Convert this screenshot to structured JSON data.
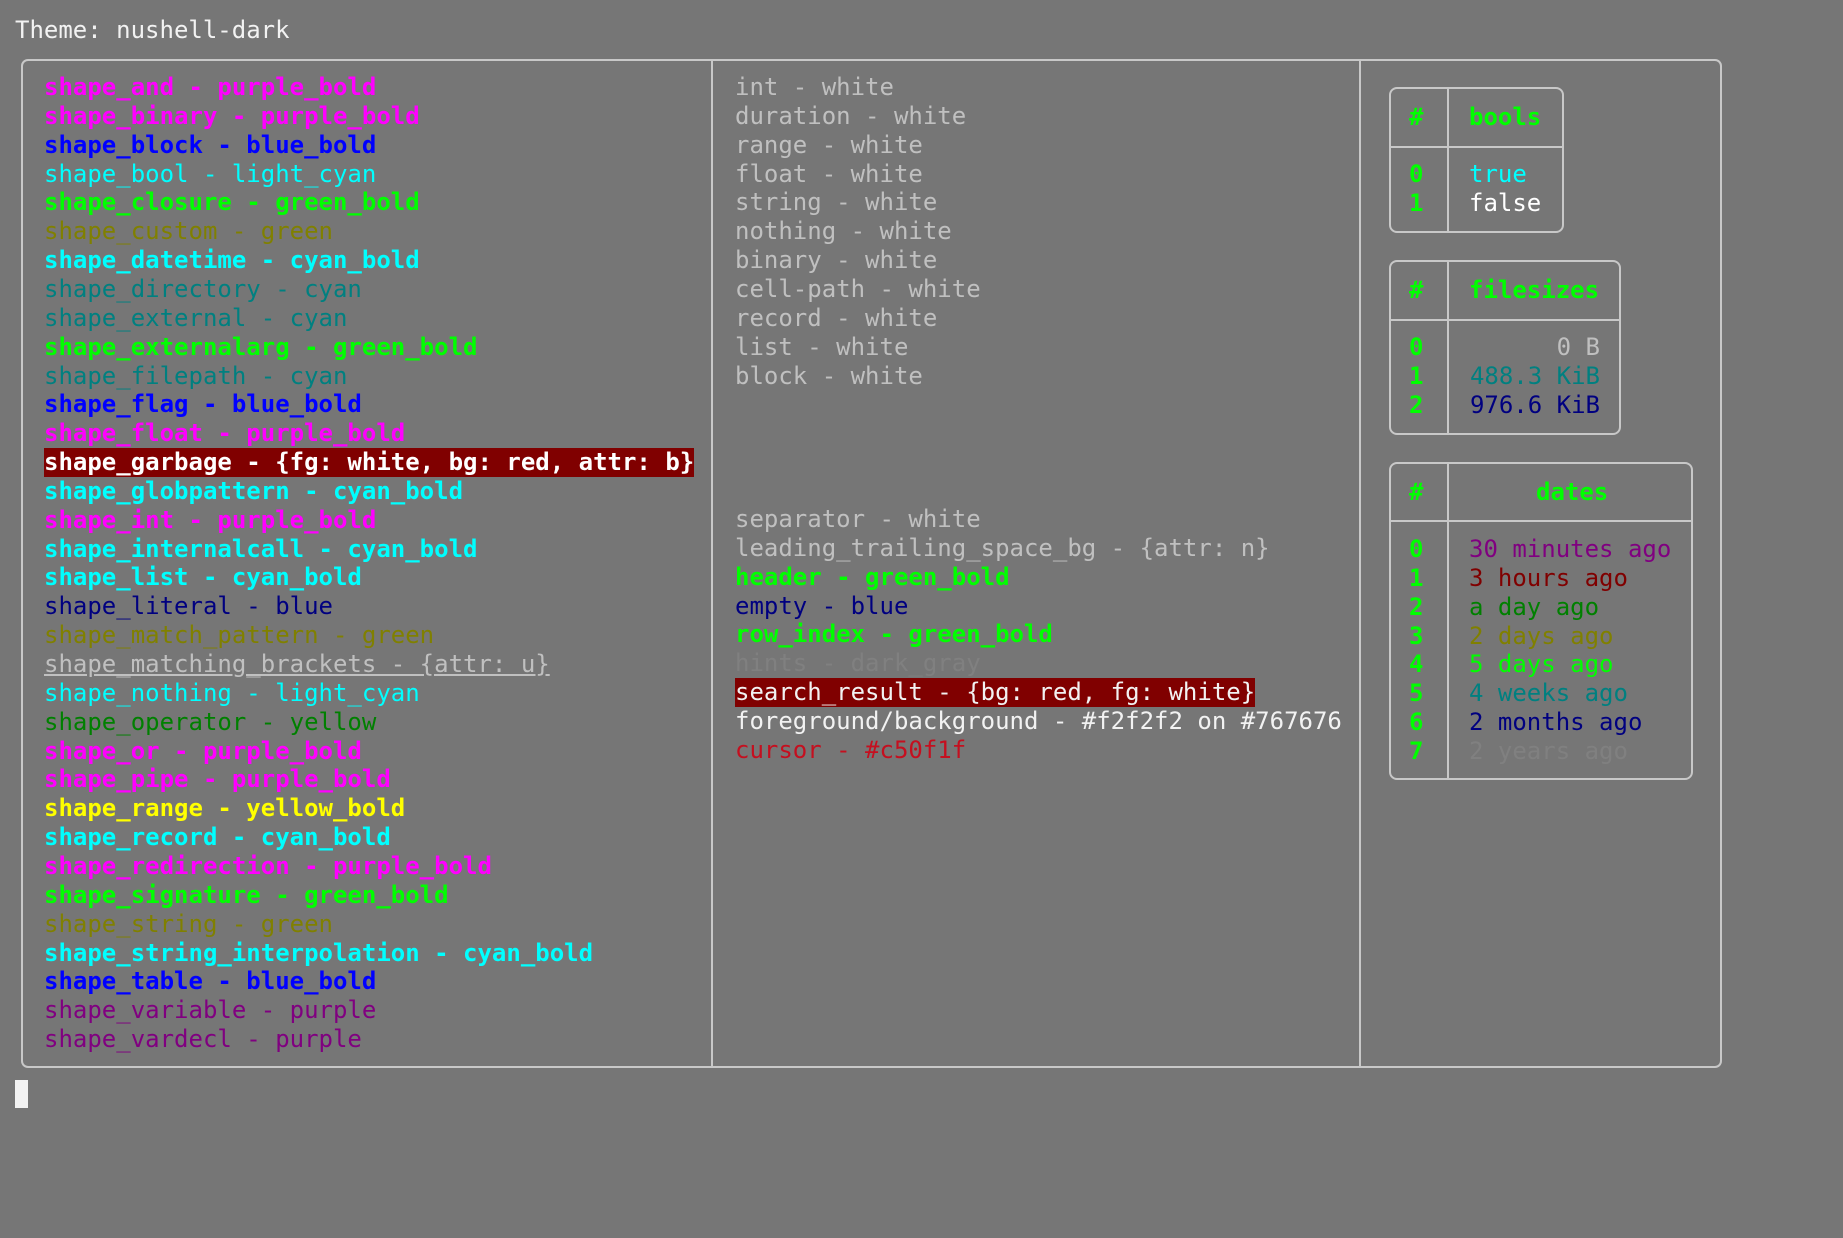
{
  "theme_title": "Theme: nushell-dark",
  "left_column": [
    {
      "text": "shape_and - purple_bold",
      "color": "#ff00ff",
      "bold": true
    },
    {
      "text": "shape_binary - purple_bold",
      "color": "#ff00ff",
      "bold": true
    },
    {
      "text": "shape_block - blue_bold",
      "color": "#0000ff",
      "bold": true
    },
    {
      "text": "shape_bool - light_cyan",
      "color": "#00ffff",
      "bold": false
    },
    {
      "text": "shape_closure - green_bold",
      "color": "#00ff00",
      "bold": true
    },
    {
      "text": "shape_custom - green",
      "color": "#808000",
      "bold": false
    },
    {
      "text": "shape_datetime - cyan_bold",
      "color": "#00ffff",
      "bold": true
    },
    {
      "text": "shape_directory - cyan",
      "color": "#008080",
      "bold": false
    },
    {
      "text": "shape_external - cyan",
      "color": "#008080",
      "bold": false
    },
    {
      "text": "shape_externalarg - green_bold",
      "color": "#00ff00",
      "bold": true
    },
    {
      "text": "shape_filepath - cyan",
      "color": "#008080",
      "bold": false
    },
    {
      "text": "shape_flag - blue_bold",
      "color": "#0000ff",
      "bold": true
    },
    {
      "text": "shape_float - purple_bold",
      "color": "#ff00ff",
      "bold": true
    },
    {
      "text": "shape_garbage - {fg: white, bg: red, attr: b}",
      "color": "#ffffff",
      "bold": true,
      "bg": "#800000"
    },
    {
      "text": "shape_globpattern - cyan_bold",
      "color": "#00ffff",
      "bold": true
    },
    {
      "text": "shape_int - purple_bold",
      "color": "#ff00ff",
      "bold": true
    },
    {
      "text": "shape_internalcall - cyan_bold",
      "color": "#00ffff",
      "bold": true
    },
    {
      "text": "shape_list - cyan_bold",
      "color": "#00ffff",
      "bold": true
    },
    {
      "text": "shape_literal - blue",
      "color": "#000080",
      "bold": false
    },
    {
      "text": "shape_match_pattern - green",
      "color": "#808000",
      "bold": false
    },
    {
      "text": "shape_matching_brackets - {attr: u}",
      "color": "#c0c0c0",
      "bold": false,
      "underline": true
    },
    {
      "text": "shape_nothing - light_cyan",
      "color": "#00ffff",
      "bold": false
    },
    {
      "text": "shape_operator - yellow",
      "color": "#008000",
      "bold": false
    },
    {
      "text": "shape_or - purple_bold",
      "color": "#ff00ff",
      "bold": true
    },
    {
      "text": "shape_pipe - purple_bold",
      "color": "#ff00ff",
      "bold": true
    },
    {
      "text": "shape_range - yellow_bold",
      "color": "#ffff00",
      "bold": true
    },
    {
      "text": "shape_record - cyan_bold",
      "color": "#00ffff",
      "bold": true
    },
    {
      "text": "shape_redirection - purple_bold",
      "color": "#ff00ff",
      "bold": true
    },
    {
      "text": "shape_signature - green_bold",
      "color": "#00ff00",
      "bold": true
    },
    {
      "text": "shape_string - green",
      "color": "#808000",
      "bold": false
    },
    {
      "text": "shape_string_interpolation - cyan_bold",
      "color": "#00ffff",
      "bold": true
    },
    {
      "text": "shape_table - blue_bold",
      "color": "#0000ff",
      "bold": true
    },
    {
      "text": "shape_variable - purple",
      "color": "#800080",
      "bold": false
    },
    {
      "text": "shape_vardecl - purple",
      "color": "#800080",
      "bold": false
    }
  ],
  "middle_column_top": [
    {
      "text": "int - white",
      "color": "#c0c0c0"
    },
    {
      "text": "duration - white",
      "color": "#c0c0c0"
    },
    {
      "text": "range - white",
      "color": "#c0c0c0"
    },
    {
      "text": "float - white",
      "color": "#c0c0c0"
    },
    {
      "text": "string - white",
      "color": "#c0c0c0"
    },
    {
      "text": "nothing - white",
      "color": "#c0c0c0"
    },
    {
      "text": "binary - white",
      "color": "#c0c0c0"
    },
    {
      "text": "cell-path - white",
      "color": "#c0c0c0"
    },
    {
      "text": "record - white",
      "color": "#c0c0c0"
    },
    {
      "text": "list - white",
      "color": "#c0c0c0"
    },
    {
      "text": "block - white",
      "color": "#c0c0c0"
    }
  ],
  "middle_column_bottom": [
    {
      "text": "separator - white",
      "color": "#c0c0c0",
      "bold": false
    },
    {
      "text": "leading_trailing_space_bg - {attr: n}",
      "color": "#c0c0c0",
      "bold": false
    },
    {
      "text": "header - green_bold",
      "color": "#00ff00",
      "bold": true
    },
    {
      "text": "empty - blue",
      "color": "#000080",
      "bold": false
    },
    {
      "text": "row_index - green_bold",
      "color": "#00ff00",
      "bold": true
    },
    {
      "text": "hints - dark_gray",
      "color": "#808080",
      "bold": false
    },
    {
      "text": "search_result - {bg: red, fg: white}",
      "color": "#f2f2f2",
      "bold": false,
      "bg": "#800000"
    },
    {
      "text": "foreground/background - #f2f2f2 on #767676",
      "color": "#f2f2f2",
      "bold": false
    },
    {
      "text": "cursor - #c50f1f",
      "color": "#c50f1f",
      "bold": false
    }
  ],
  "tables": {
    "bools": {
      "index_header": "#",
      "header": "bools",
      "rows": [
        {
          "index": "0",
          "value": "true",
          "color": "#00ffff"
        },
        {
          "index": "1",
          "value": "false",
          "color": "#ffffff"
        }
      ]
    },
    "filesizes": {
      "index_header": "#",
      "header": "filesizes",
      "rows": [
        {
          "index": "0",
          "value": "0 B",
          "color": "#c0c0c0"
        },
        {
          "index": "1",
          "value": "488.3 KiB",
          "color": "#008080"
        },
        {
          "index": "2",
          "value": "976.6 KiB",
          "color": "#000080"
        }
      ]
    },
    "dates": {
      "index_header": "#",
      "header": "dates",
      "rows": [
        {
          "index": "0",
          "value": "30 minutes ago",
          "color": "#800080"
        },
        {
          "index": "1",
          "value": "3 hours ago",
          "color": "#800000"
        },
        {
          "index": "2",
          "value": "a day ago",
          "color": "#008000"
        },
        {
          "index": "3",
          "value": "2 days ago",
          "color": "#808000"
        },
        {
          "index": "4",
          "value": "5 days ago",
          "color": "#00ff00"
        },
        {
          "index": "5",
          "value": "4 weeks ago",
          "color": "#008080"
        },
        {
          "index": "6",
          "value": "2 months ago",
          "color": "#000080"
        },
        {
          "index": "7",
          "value": "2 years ago",
          "color": "#808080"
        }
      ]
    }
  },
  "colors": {
    "background": "#767676",
    "foreground": "#f2f2f2",
    "cursor": "#c50f1f",
    "border": "#c8c8c8"
  }
}
